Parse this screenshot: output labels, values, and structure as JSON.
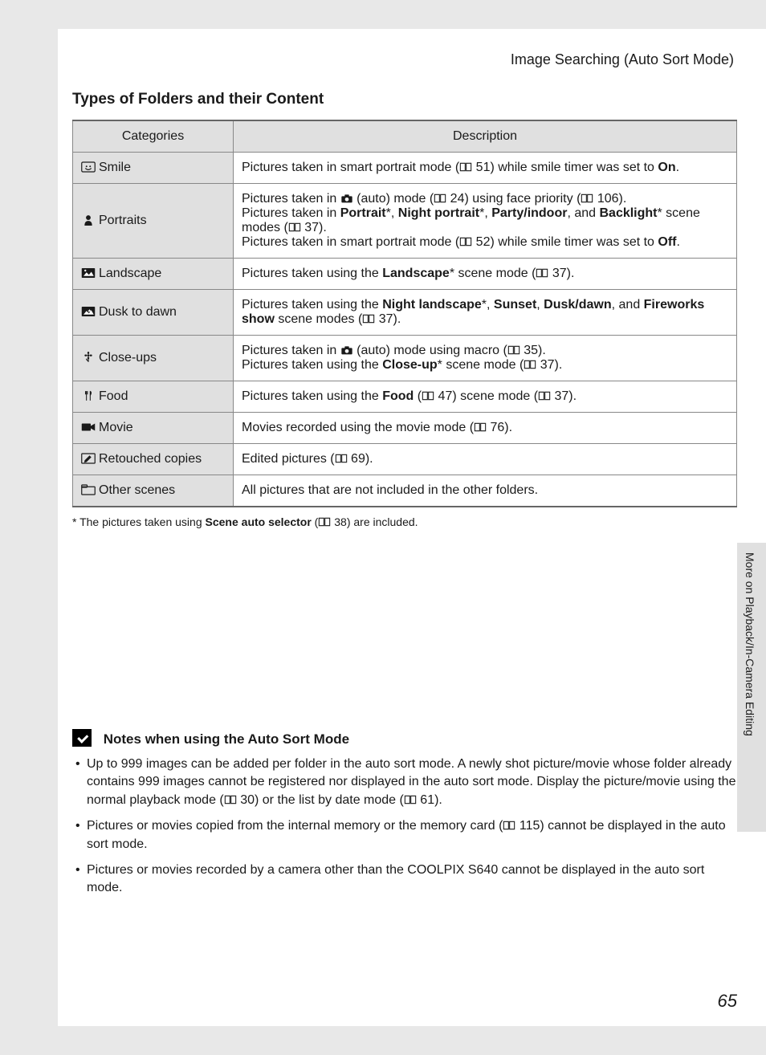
{
  "header": "Image Searching (Auto Sort Mode)",
  "section_heading": "Types of Folders and their Content",
  "table": {
    "headers": {
      "cat": "Categories",
      "desc": "Description"
    },
    "rows": [
      {
        "icon": "smile-icon",
        "label": "Smile",
        "desc": "Pictures taken in smart portrait mode (📖 51) while smile timer was set to <b>On</b>."
      },
      {
        "icon": "portrait-icon",
        "label": "Portraits",
        "desc": "Pictures taken in 📷 (auto) mode (📖 24) using face priority (📖 106).<br>Pictures taken in <b>Portrait</b>*, <b>Night portrait</b>*, <b>Party/indoor</b>, and <b>Backlight</b>* scene modes (📖 37).<br>Pictures taken in smart portrait mode (📖 52) while smile timer was set to <b>Off</b>."
      },
      {
        "icon": "landscape-icon",
        "label": "Landscape",
        "desc": "Pictures taken using the <b>Landscape</b>* scene mode (📖 37)."
      },
      {
        "icon": "dusk-icon",
        "label": "Dusk to dawn",
        "desc": "Pictures taken using the <b>Night landscape</b>*, <b>Sunset</b>, <b>Dusk/dawn</b>, and <b>Fireworks show</b> scene modes (📖 37)."
      },
      {
        "icon": "closeup-icon",
        "label": "Close-ups",
        "desc": "Pictures taken in 📷 (auto) mode using macro (📖 35).<br>Pictures taken using the <b>Close-up</b>* scene mode (📖 37)."
      },
      {
        "icon": "food-icon",
        "label": "Food",
        "desc": "Pictures taken using the <b>Food</b> (📖 47) scene mode (📖 37)."
      },
      {
        "icon": "movie-icon",
        "label": "Movie",
        "desc": "Movies recorded using the movie mode (📖 76)."
      },
      {
        "icon": "retouch-icon",
        "label": "Retouched copies",
        "desc": "Edited pictures (📖 69)."
      },
      {
        "icon": "other-icon",
        "label": "Other scenes",
        "desc": "All pictures that are not included in the other folders."
      }
    ]
  },
  "footnote": "*   The pictures taken using <b>Scene auto selector</b> (📖 38) are included.",
  "notes": {
    "heading": "Notes when using the Auto Sort Mode",
    "items": [
      "Up to 999 images can be added per folder in the auto sort mode. A newly shot picture/movie whose folder already contains 999 images cannot be registered nor displayed in the auto sort mode. Display the picture/movie using the normal playback mode (📖 30) or the list by date mode (📖 61).",
      "Pictures or movies copied from the internal memory or the memory card (📖 115) cannot be displayed in the auto sort mode.",
      "Pictures or movies recorded by a camera other than the COOLPIX S640 cannot be displayed in the auto sort mode."
    ]
  },
  "side_tab": "More on Playback/In-Camera Editing",
  "page_number": "65"
}
